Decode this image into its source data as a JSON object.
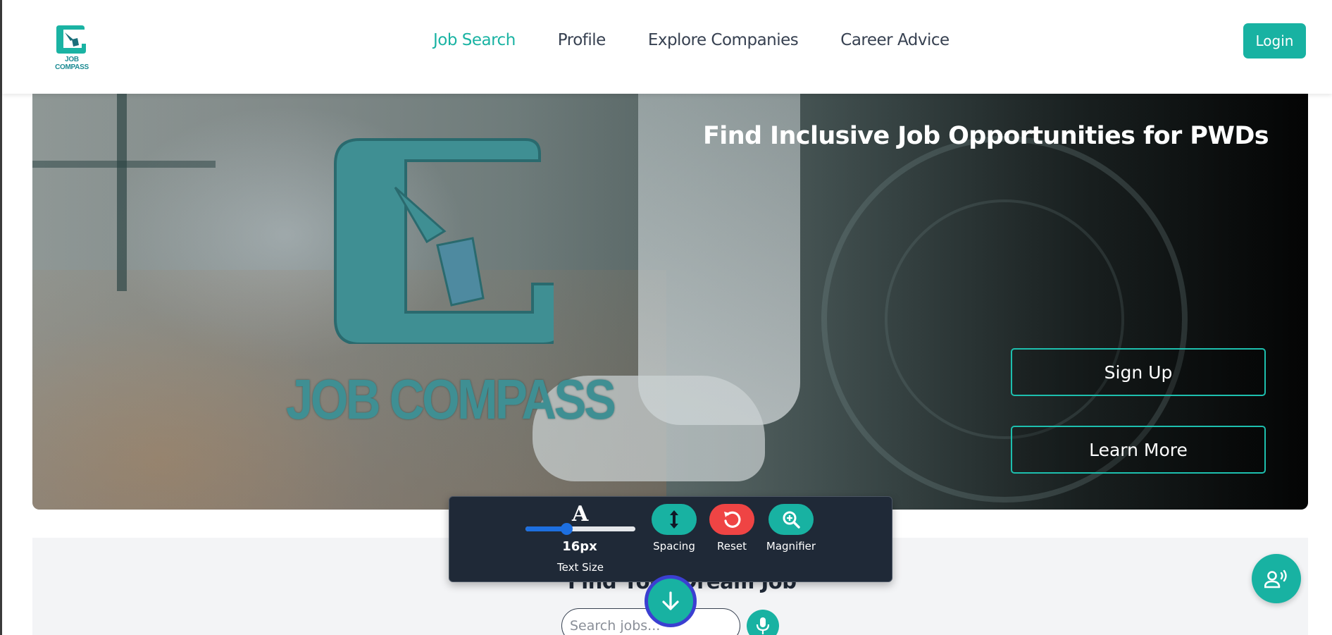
{
  "header": {
    "logo_text": "JOB COMPASS",
    "nav": [
      {
        "label": "Job Search",
        "active": true
      },
      {
        "label": "Profile",
        "active": false
      },
      {
        "label": "Explore Companies",
        "active": false
      },
      {
        "label": "Career Advice",
        "active": false
      }
    ],
    "login_label": "Login"
  },
  "hero": {
    "title": "Find Inclusive Job Opportunities for PWDs",
    "logo_text": "JOB COMPASS",
    "signup_label": "Sign Up",
    "learn_more_label": "Learn More"
  },
  "search": {
    "heading": "Find Your Dream Job",
    "placeholder": "Search jobs..."
  },
  "accessibility_toolbar": {
    "text_size_glyph": "A",
    "text_size_value": "16px",
    "text_size_label": "Text Size",
    "text_size_slider_fraction": 0.37,
    "spacing_label": "Spacing",
    "reset_label": "Reset",
    "magnifier_label": "Magnifier"
  },
  "colors": {
    "accent": "#18b2a2",
    "nav_active": "#1ab3a3",
    "reset": "#ef4444",
    "toolbar_bg": "#1f2937",
    "slider": "#1d6fe0"
  },
  "icons": {
    "spacing": "vertical-arrows-icon",
    "reset": "undo-icon",
    "magnifier": "zoom-in-icon",
    "scroll": "arrow-down-icon",
    "voice": "voice-assistant-icon",
    "mic": "microphone-icon"
  }
}
